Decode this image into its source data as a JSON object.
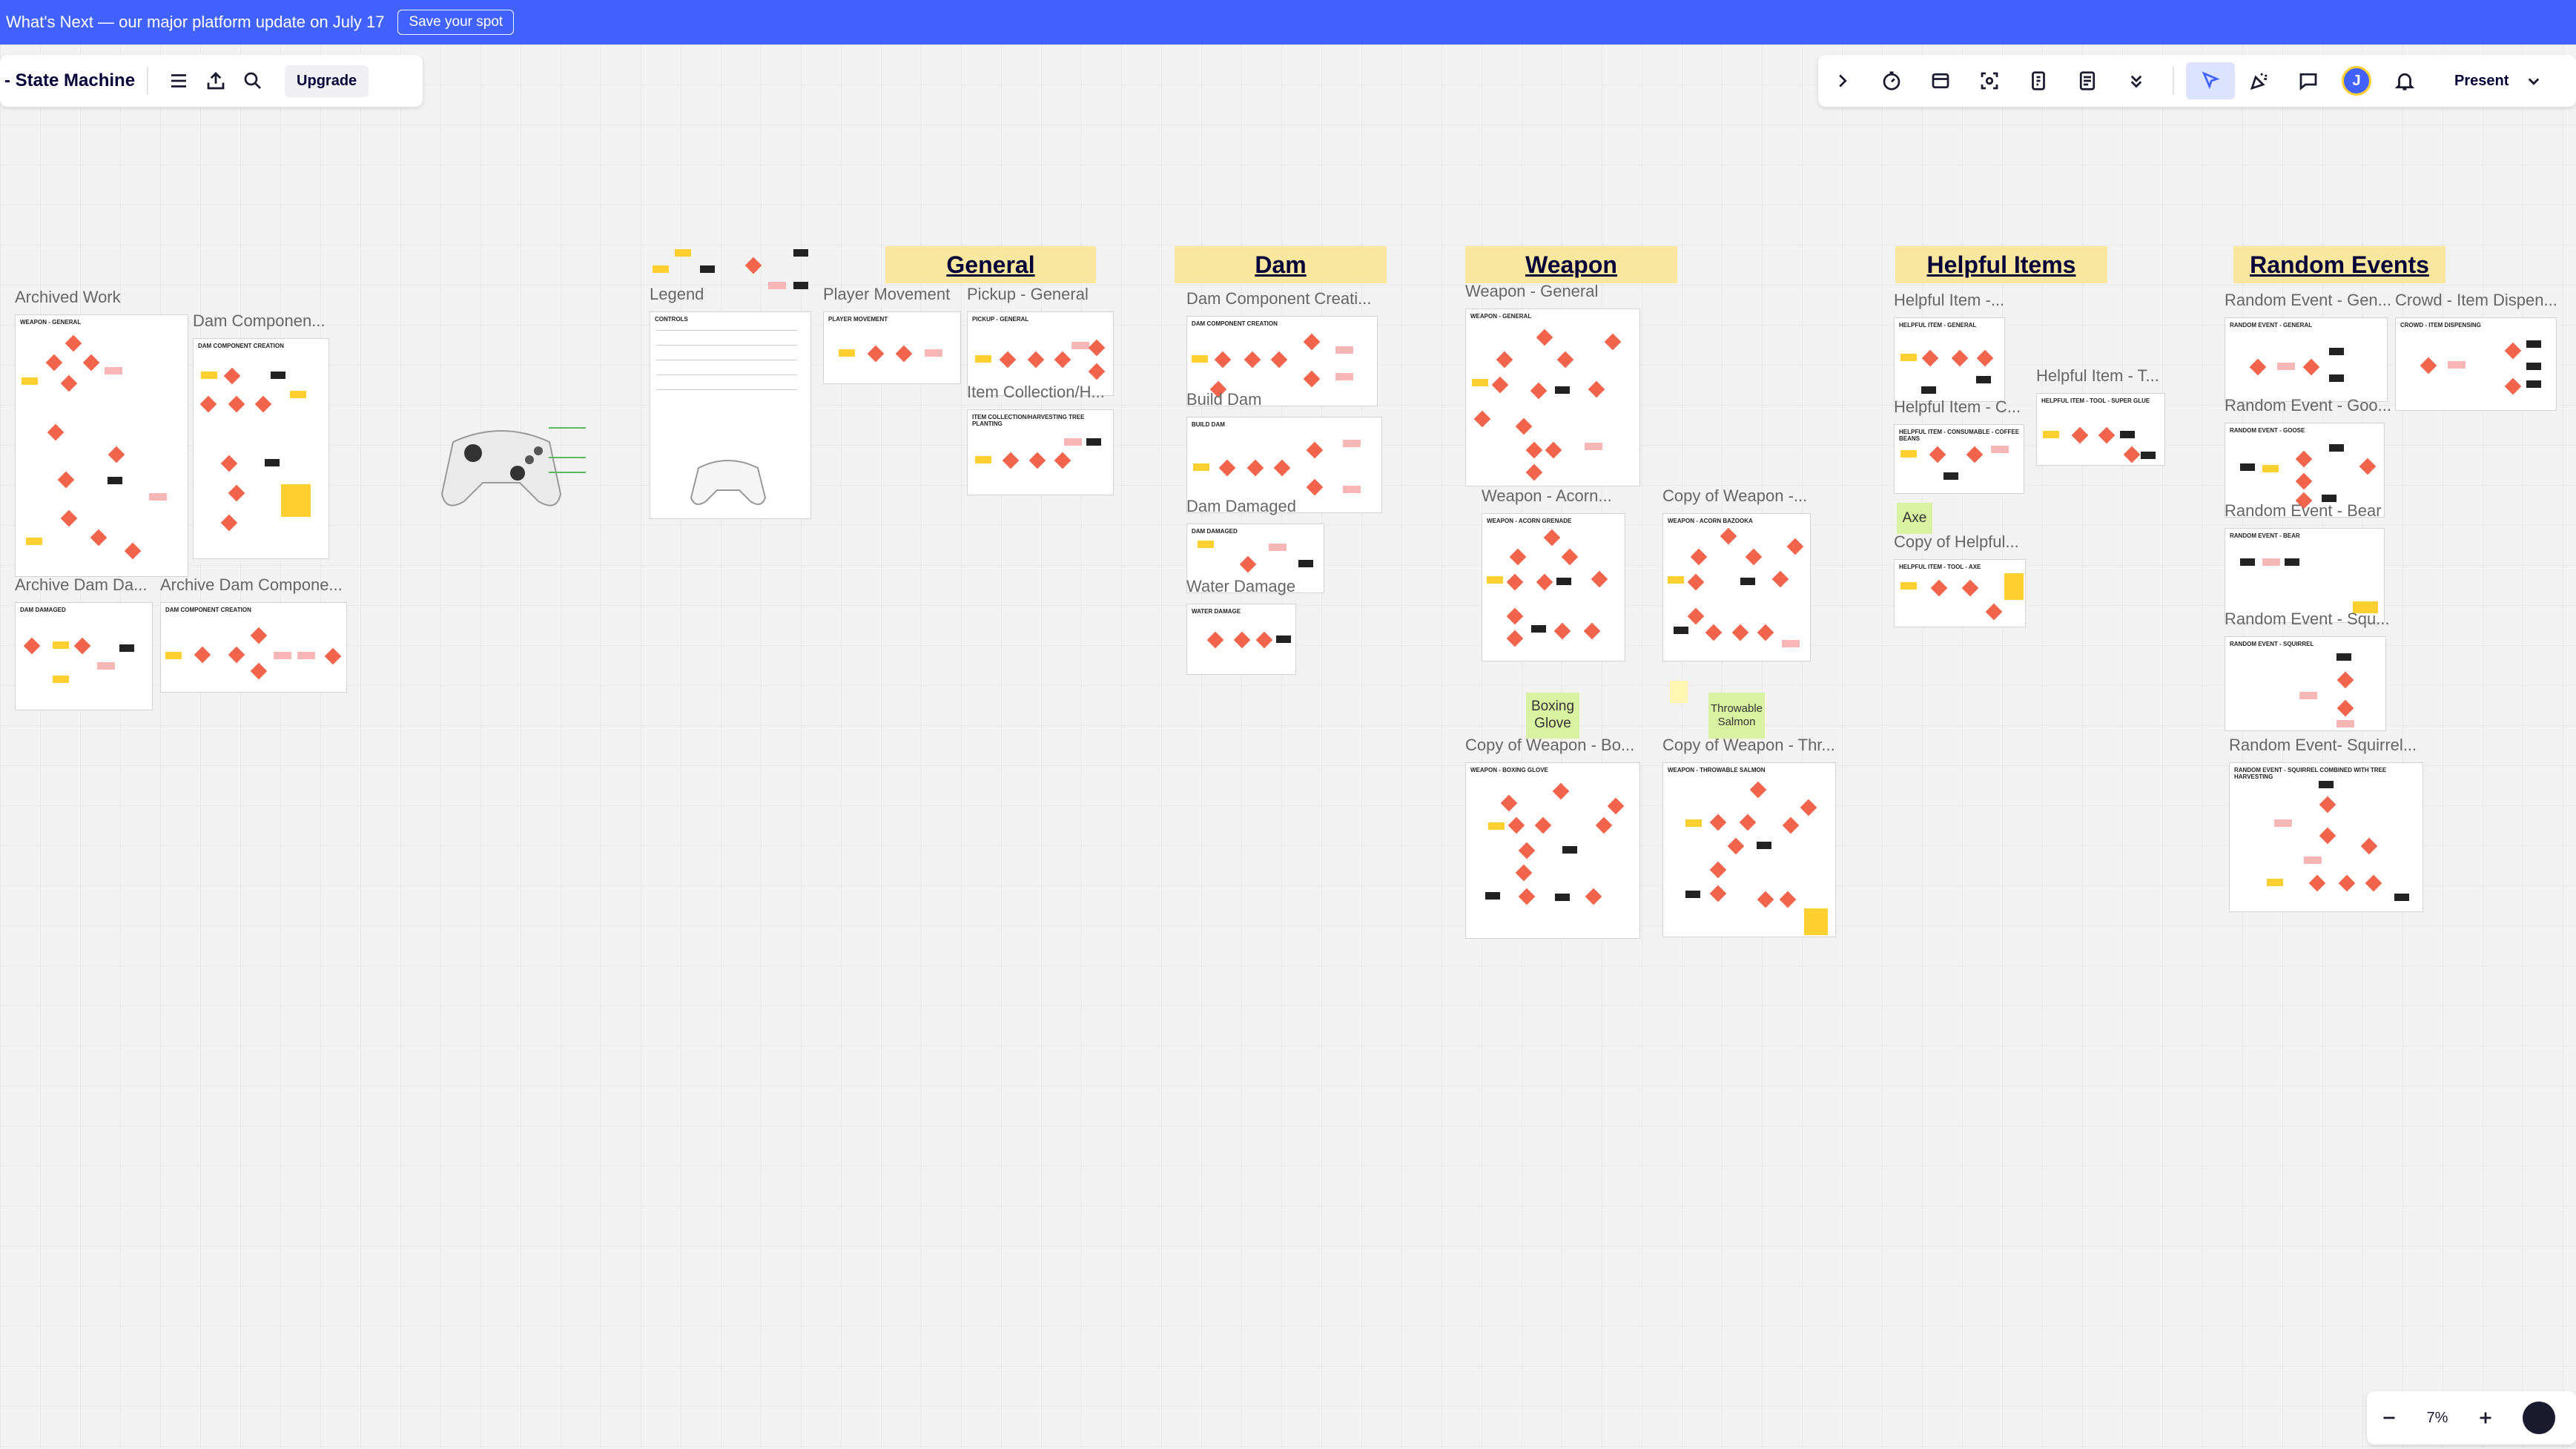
{
  "banner": {
    "message": "What's Next — our major platform update on July 17",
    "button": "Save your spot"
  },
  "toolbar_left": {
    "title": "- State Machine",
    "upgrade": "Upgrade"
  },
  "toolbar_right": {
    "avatar_initial": "J",
    "present": "Present"
  },
  "zoom": {
    "value": "7%"
  },
  "headers": [
    "General",
    "Dam",
    "Weapon",
    "Helpful Items",
    "Random Events"
  ],
  "labels": {
    "archived_work": "Archived Work",
    "dam_component": "Dam Componen...",
    "archive_dam_da": "Archive Dam Da...",
    "archive_dam_component": "Archive Dam Compone...",
    "legend": "Legend",
    "player_movement": "Player Movement",
    "pickup_general": "Pickup - General",
    "item_collection": "Item Collection/H...",
    "dam_component_creation": "Dam Component Creati...",
    "build_dam": "Build Dam",
    "dam_damaged": "Dam Damaged",
    "water_damage": "Water Damage",
    "weapon_general": "Weapon - General",
    "weapon_acorn": "Weapon - Acorn...",
    "copy_weapon": "Copy of  Weapon -...",
    "copy_weapon_bo": "Copy of  Weapon - Bo...",
    "copy_weapon_thr": "Copy of Weapon - Thr...",
    "helpful_item_1": "Helpful Item -...",
    "helpful_item_c": "Helpful Item - C...",
    "helpful_item_t": "Helpful Item - T...",
    "copy_helpful": "Copy of Helpful...",
    "random_gen": "Random Event - Gen...",
    "crowd_item": "Crowd - Item Dispen...",
    "random_goo": "Random Event - Goo...",
    "random_bear": "Random Event - Bear",
    "random_squ": "Random Event - Squ...",
    "random_squirrel": "Random Event- Squirrel..."
  },
  "stickies": {
    "axe": "Axe",
    "boxing_glove": "Boxing Glove",
    "throwable_salmon": "Throwable Salmon"
  },
  "frame_titles": {
    "weapon_general": "WEAPON - GENERAL",
    "dam_component_creation": "DAM COMPONENT CREATION",
    "dam_damaged": "DAM DAMAGED",
    "player_movement": "PLAYER MOVEMENT",
    "pickup_general": "PICKUP - GENERAL",
    "item_collection": "ITEM COLLECTION/HARVESTING TREE PLANTING",
    "build_dam": "BUILD DAM",
    "water_damage": "WATER DAMAGE",
    "weapon_acorn": "WEAPON - ACORN GRENADE",
    "weapon_acorn_bazooka": "WEAPON - ACORN BAZOOKA",
    "weapon_boxing": "WEAPON - BOXING GLOVE",
    "weapon_salmon": "WEAPON - THROWABLE SALMON",
    "helpful_general": "HELPFUL ITEM - GENERAL",
    "helpful_coffee": "HELPFUL ITEM - CONSUMABLE - COFFEE BEANS",
    "helpful_glue": "HELPFUL ITEM - TOOL - SUPER GLUE",
    "helpful_axe": "HELPFUL ITEM - TOOL - AXE",
    "random_general": "RANDOM EVENT - GENERAL",
    "crowd_item": "CROWD - ITEM DISPENSING",
    "random_goose": "RANDOM EVENT - GOOSE",
    "random_bear": "RANDOM EVENT - BEAR",
    "random_squirrel": "RANDOM EVENT - SQUIRREL",
    "random_squirrel_combined": "RANDOM EVENT - SQUIRREL COMBINED WITH TREE HARVESTING",
    "controls": "Controls"
  }
}
